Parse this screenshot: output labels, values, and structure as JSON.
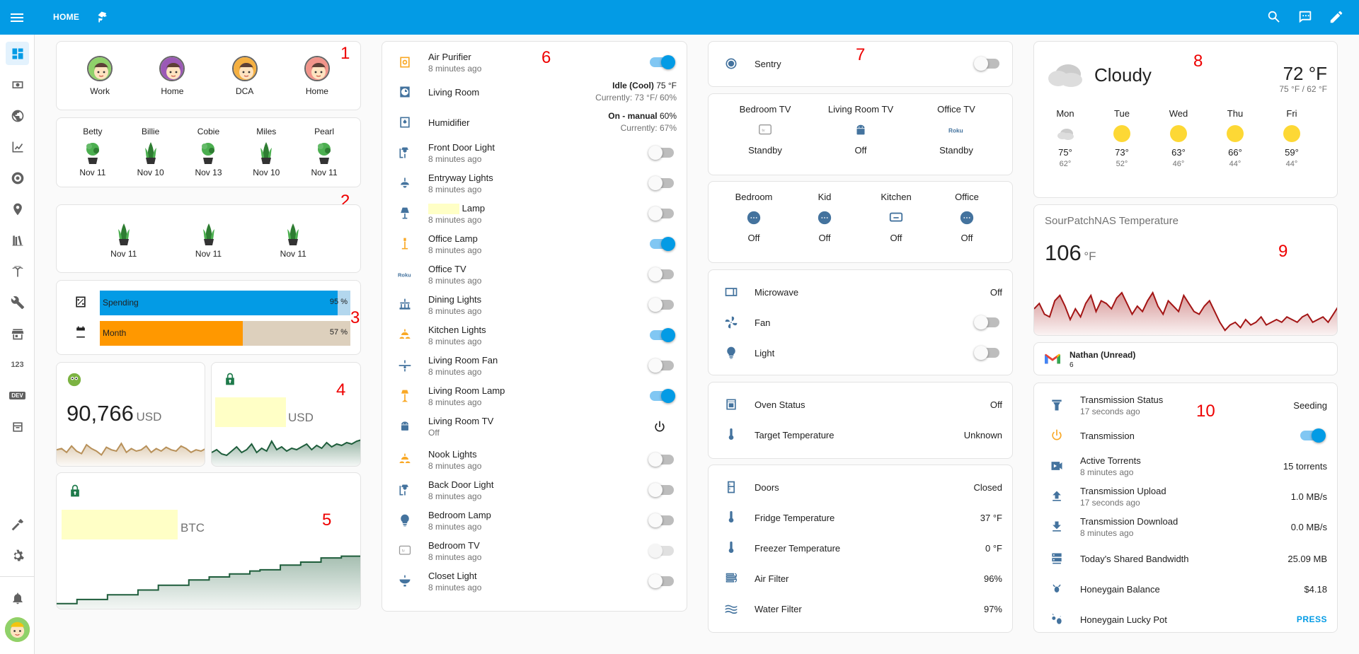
{
  "header": {
    "title": "HOME"
  },
  "badges": {
    "b1": "1",
    "b2": "2",
    "b3": "3",
    "b4": "4",
    "b5": "5",
    "b6": "6",
    "b7": "7",
    "b8": "8",
    "b9": "9",
    "b10": "10"
  },
  "sidebar": {
    "counter_label": "123",
    "dev_label": "DEV"
  },
  "persons": [
    {
      "name": "Work",
      "color": "#8fd16a"
    },
    {
      "name": "Home",
      "color": "#9b59b6"
    },
    {
      "name": "DCA",
      "color": "#f5b041"
    },
    {
      "name": "Home",
      "color": "#f1948a"
    }
  ],
  "plants_named": [
    {
      "name": "Betty",
      "date": "Nov 11"
    },
    {
      "name": "Billie",
      "date": "Nov 10"
    },
    {
      "name": "Cobie",
      "date": "Nov 13"
    },
    {
      "name": "Miles",
      "date": "Nov 10"
    },
    {
      "name": "Pearl",
      "date": "Nov 11"
    }
  ],
  "plants_unnamed": [
    {
      "date": "Nov 11"
    },
    {
      "date": "Nov 11"
    },
    {
      "date": "Nov 11"
    }
  ],
  "bars": [
    {
      "label": "Spending",
      "value": 95,
      "pct": "95 %",
      "color": "#039be5",
      "track": "#b3d7ee"
    },
    {
      "label": "Month",
      "value": 57,
      "pct": "57 %",
      "color": "#ff9800",
      "track": "#ddd0bd"
    }
  ],
  "sensor4a": {
    "value": "90,766",
    "unit": "USD"
  },
  "sensor4b": {
    "unit": "USD"
  },
  "sensor5": {
    "unit": "BTC"
  },
  "lights": [
    {
      "name": "Air Purifier",
      "sub": "8 minutes ago",
      "type": "toggle",
      "on": true,
      "icon": "air-purifier-icon"
    },
    {
      "name": "Living Room",
      "type": "climate",
      "state": "Idle (Cool)",
      "target": "75 °F",
      "current": "Currently: 73 °F/ 60%",
      "icon": "thermostat-icon"
    },
    {
      "name": "Humidifier",
      "type": "climate",
      "state": "On - manual",
      "target": "60%",
      "current": "Currently: 67%",
      "icon": "humidifier-icon"
    },
    {
      "name": "Front Door Light",
      "sub": "8 minutes ago",
      "type": "toggle",
      "on": false,
      "icon": "outdoor-lamp-icon"
    },
    {
      "name": "Entryway Lights",
      "sub": "8 minutes ago",
      "type": "toggle",
      "on": false,
      "icon": "ceiling-light-icon"
    },
    {
      "name": "Lamp",
      "sub": "8 minutes ago",
      "type": "toggle",
      "on": false,
      "icon": "lamp-icon",
      "redacted": true
    },
    {
      "name": "Office Lamp",
      "sub": "8 minutes ago",
      "type": "toggle",
      "on": true,
      "icon": "desk-lamp-icon"
    },
    {
      "name": "Office TV",
      "sub": "8 minutes ago",
      "type": "toggle",
      "on": false,
      "icon": "roku-icon"
    },
    {
      "name": "Dining Lights",
      "sub": "8 minutes ago",
      "type": "toggle",
      "on": false,
      "icon": "chandelier-icon"
    },
    {
      "name": "Kitchen Lights",
      "sub": "8 minutes ago",
      "type": "toggle",
      "on": true,
      "icon": "ceiling-light-multi-icon"
    },
    {
      "name": "Living Room Fan",
      "sub": "8 minutes ago",
      "type": "toggle",
      "on": false,
      "icon": "ceiling-fan-icon"
    },
    {
      "name": "Living Room Lamp",
      "sub": "8 minutes ago",
      "type": "toggle",
      "on": true,
      "icon": "floor-lamp-icon"
    },
    {
      "name": "Living Room TV",
      "sub": "Off",
      "type": "power",
      "icon": "android-icon"
    },
    {
      "name": "Nook Lights",
      "sub": "8 minutes ago",
      "type": "toggle",
      "on": false,
      "icon": "ceiling-light-multi-icon"
    },
    {
      "name": "Back Door Light",
      "sub": "8 minutes ago",
      "type": "toggle",
      "on": false,
      "icon": "outdoor-lamp-icon"
    },
    {
      "name": "Bedroom Lamp",
      "sub": "8 minutes ago",
      "type": "toggle",
      "on": false,
      "icon": "lightbulb-icon"
    },
    {
      "name": "Bedroom TV",
      "sub": "8 minutes ago",
      "type": "toggle",
      "on": false,
      "disabled": true,
      "icon": "apple-tv-icon"
    },
    {
      "name": "Closet Light",
      "sub": "8 minutes ago",
      "type": "toggle",
      "on": false,
      "icon": "bowl-light-icon"
    }
  ],
  "sentry": {
    "name": "Sentry"
  },
  "tvs": [
    {
      "name": "Bedroom TV",
      "state": "Standby",
      "icon": "apple-tv-icon"
    },
    {
      "name": "Living Room TV",
      "state": "Off",
      "icon": "android-icon"
    },
    {
      "name": "Office TV",
      "state": "Standby",
      "icon": "roku-icon"
    }
  ],
  "speakers": [
    {
      "name": "Bedroom",
      "state": "Off",
      "icon": "speaker-dots-icon"
    },
    {
      "name": "Kid",
      "state": "Off",
      "icon": "speaker-dots-icon"
    },
    {
      "name": "Kitchen",
      "state": "Off",
      "icon": "display-icon"
    },
    {
      "name": "Office",
      "state": "Off",
      "icon": "speaker-dots-icon"
    }
  ],
  "appliances": [
    {
      "name": "Microwave",
      "value": "Off",
      "icon": "microwave-icon",
      "type": "value"
    },
    {
      "name": "Fan",
      "icon": "fan-icon",
      "type": "toggle"
    },
    {
      "name": "Light",
      "icon": "lightbulb-icon",
      "type": "toggle"
    }
  ],
  "oven": [
    {
      "name": "Oven Status",
      "value": "Off",
      "icon": "oven-icon"
    },
    {
      "name": "Target Temperature",
      "value": "Unknown",
      "icon": "thermometer-icon"
    }
  ],
  "fridge": [
    {
      "name": "Doors",
      "value": "Closed",
      "icon": "fridge-icon"
    },
    {
      "name": "Fridge Temperature",
      "value": "37 °F",
      "icon": "thermometer-icon"
    },
    {
      "name": "Freezer Temperature",
      "value": "0 °F",
      "icon": "thermometer-icon"
    },
    {
      "name": "Air Filter",
      "value": "96%",
      "icon": "air-filter-icon"
    },
    {
      "name": "Water Filter",
      "value": "97%",
      "icon": "water-filter-icon"
    }
  ],
  "weather": {
    "condition": "Cloudy",
    "temp": "72 °F",
    "hilo": "75 °F / 62 °F",
    "forecast": [
      {
        "day": "Mon",
        "hi": "75°",
        "lo": "62°",
        "icon": "cloudy-icon"
      },
      {
        "day": "Tue",
        "hi": "73°",
        "lo": "52°",
        "icon": "sunny-icon"
      },
      {
        "day": "Wed",
        "hi": "63°",
        "lo": "46°",
        "icon": "sunny-icon"
      },
      {
        "day": "Thu",
        "hi": "66°",
        "lo": "44°",
        "icon": "sunny-icon"
      },
      {
        "day": "Fri",
        "hi": "59°",
        "lo": "44°",
        "icon": "sunny-icon"
      }
    ]
  },
  "nas": {
    "title": "SourPatchNAS Temperature",
    "value": "106",
    "unit": "°F"
  },
  "gmail": {
    "name": "Nathan (Unread)",
    "count": "6"
  },
  "transmission": [
    {
      "name": "Transmission Status",
      "sub": "17 seconds ago",
      "value": "Seeding",
      "icon": "transmission-icon",
      "type": "value"
    },
    {
      "name": "Transmission",
      "type": "toggle",
      "on": true,
      "icon": "power-icon"
    },
    {
      "name": "Active Torrents",
      "sub": "8 minutes ago",
      "value": "15 torrents",
      "icon": "video-switch-icon",
      "type": "value"
    },
    {
      "name": "Transmission Upload",
      "sub": "17 seconds ago",
      "value": "1.0 MB/s",
      "icon": "upload-icon",
      "type": "value"
    },
    {
      "name": "Transmission Download",
      "sub": "8 minutes ago",
      "value": "0.0 MB/s",
      "icon": "download-icon",
      "type": "value"
    },
    {
      "name": "Today's Shared Bandwidth",
      "value": "25.09 MB",
      "icon": "server-icon",
      "type": "value"
    },
    {
      "name": "Honeygain Balance",
      "value": "$4.18",
      "icon": "bee-icon",
      "type": "value"
    },
    {
      "name": "Honeygain Lucky Pot",
      "value": "PRESS",
      "icon": "bee-flower-icon",
      "type": "button"
    }
  ],
  "charts": {
    "usd_a": [
      0.55,
      0.6,
      0.45,
      0.7,
      0.5,
      0.4,
      0.75,
      0.6,
      0.5,
      0.35,
      0.65,
      0.55,
      0.5,
      0.8,
      0.45,
      0.6,
      0.5,
      0.55,
      0.7,
      0.45,
      0.6,
      0.5,
      0.65,
      0.55,
      0.5,
      0.7,
      0.6,
      0.45,
      0.55,
      0.5,
      0.6
    ],
    "usd_b": [
      0.4,
      0.5,
      0.35,
      0.3,
      0.45,
      0.6,
      0.4,
      0.5,
      0.7,
      0.4,
      0.55,
      0.45,
      0.8,
      0.5,
      0.6,
      0.45,
      0.55,
      0.5,
      0.6,
      0.7,
      0.5,
      0.65,
      0.55,
      0.75,
      0.6,
      0.7,
      0.65,
      0.75,
      0.7,
      0.8,
      0.85
    ],
    "btc": [
      0.05,
      0.05,
      0.12,
      0.12,
      0.12,
      0.2,
      0.2,
      0.2,
      0.28,
      0.28,
      0.36,
      0.36,
      0.36,
      0.45,
      0.45,
      0.5,
      0.5,
      0.55,
      0.55,
      0.6,
      0.62,
      0.62,
      0.7,
      0.7,
      0.75,
      0.75,
      0.82,
      0.82,
      0.85,
      0.85,
      0.98
    ],
    "nas": [
      0.45,
      0.55,
      0.35,
      0.3,
      0.6,
      0.7,
      0.5,
      0.25,
      0.45,
      0.3,
      0.55,
      0.7,
      0.4,
      0.6,
      0.55,
      0.45,
      0.65,
      0.75,
      0.55,
      0.35,
      0.5,
      0.4,
      0.6,
      0.75,
      0.5,
      0.35,
      0.6,
      0.5,
      0.4,
      0.7,
      0.55,
      0.4,
      0.35,
      0.5,
      0.6,
      0.4,
      0.2,
      0.05,
      0.15,
      0.2,
      0.1,
      0.25,
      0.15,
      0.2,
      0.3,
      0.15,
      0.2,
      0.25,
      0.2,
      0.3,
      0.25,
      0.2,
      0.3,
      0.35,
      0.2,
      0.25,
      0.3,
      0.2,
      0.35,
      0.5
    ]
  },
  "colors": {
    "accent": "#039be5",
    "icon": "#44739e",
    "usd_a": "#b8915a",
    "usd_b": "#1e5d3b",
    "btc": "#1e5d3b",
    "nas": "#a31515"
  }
}
